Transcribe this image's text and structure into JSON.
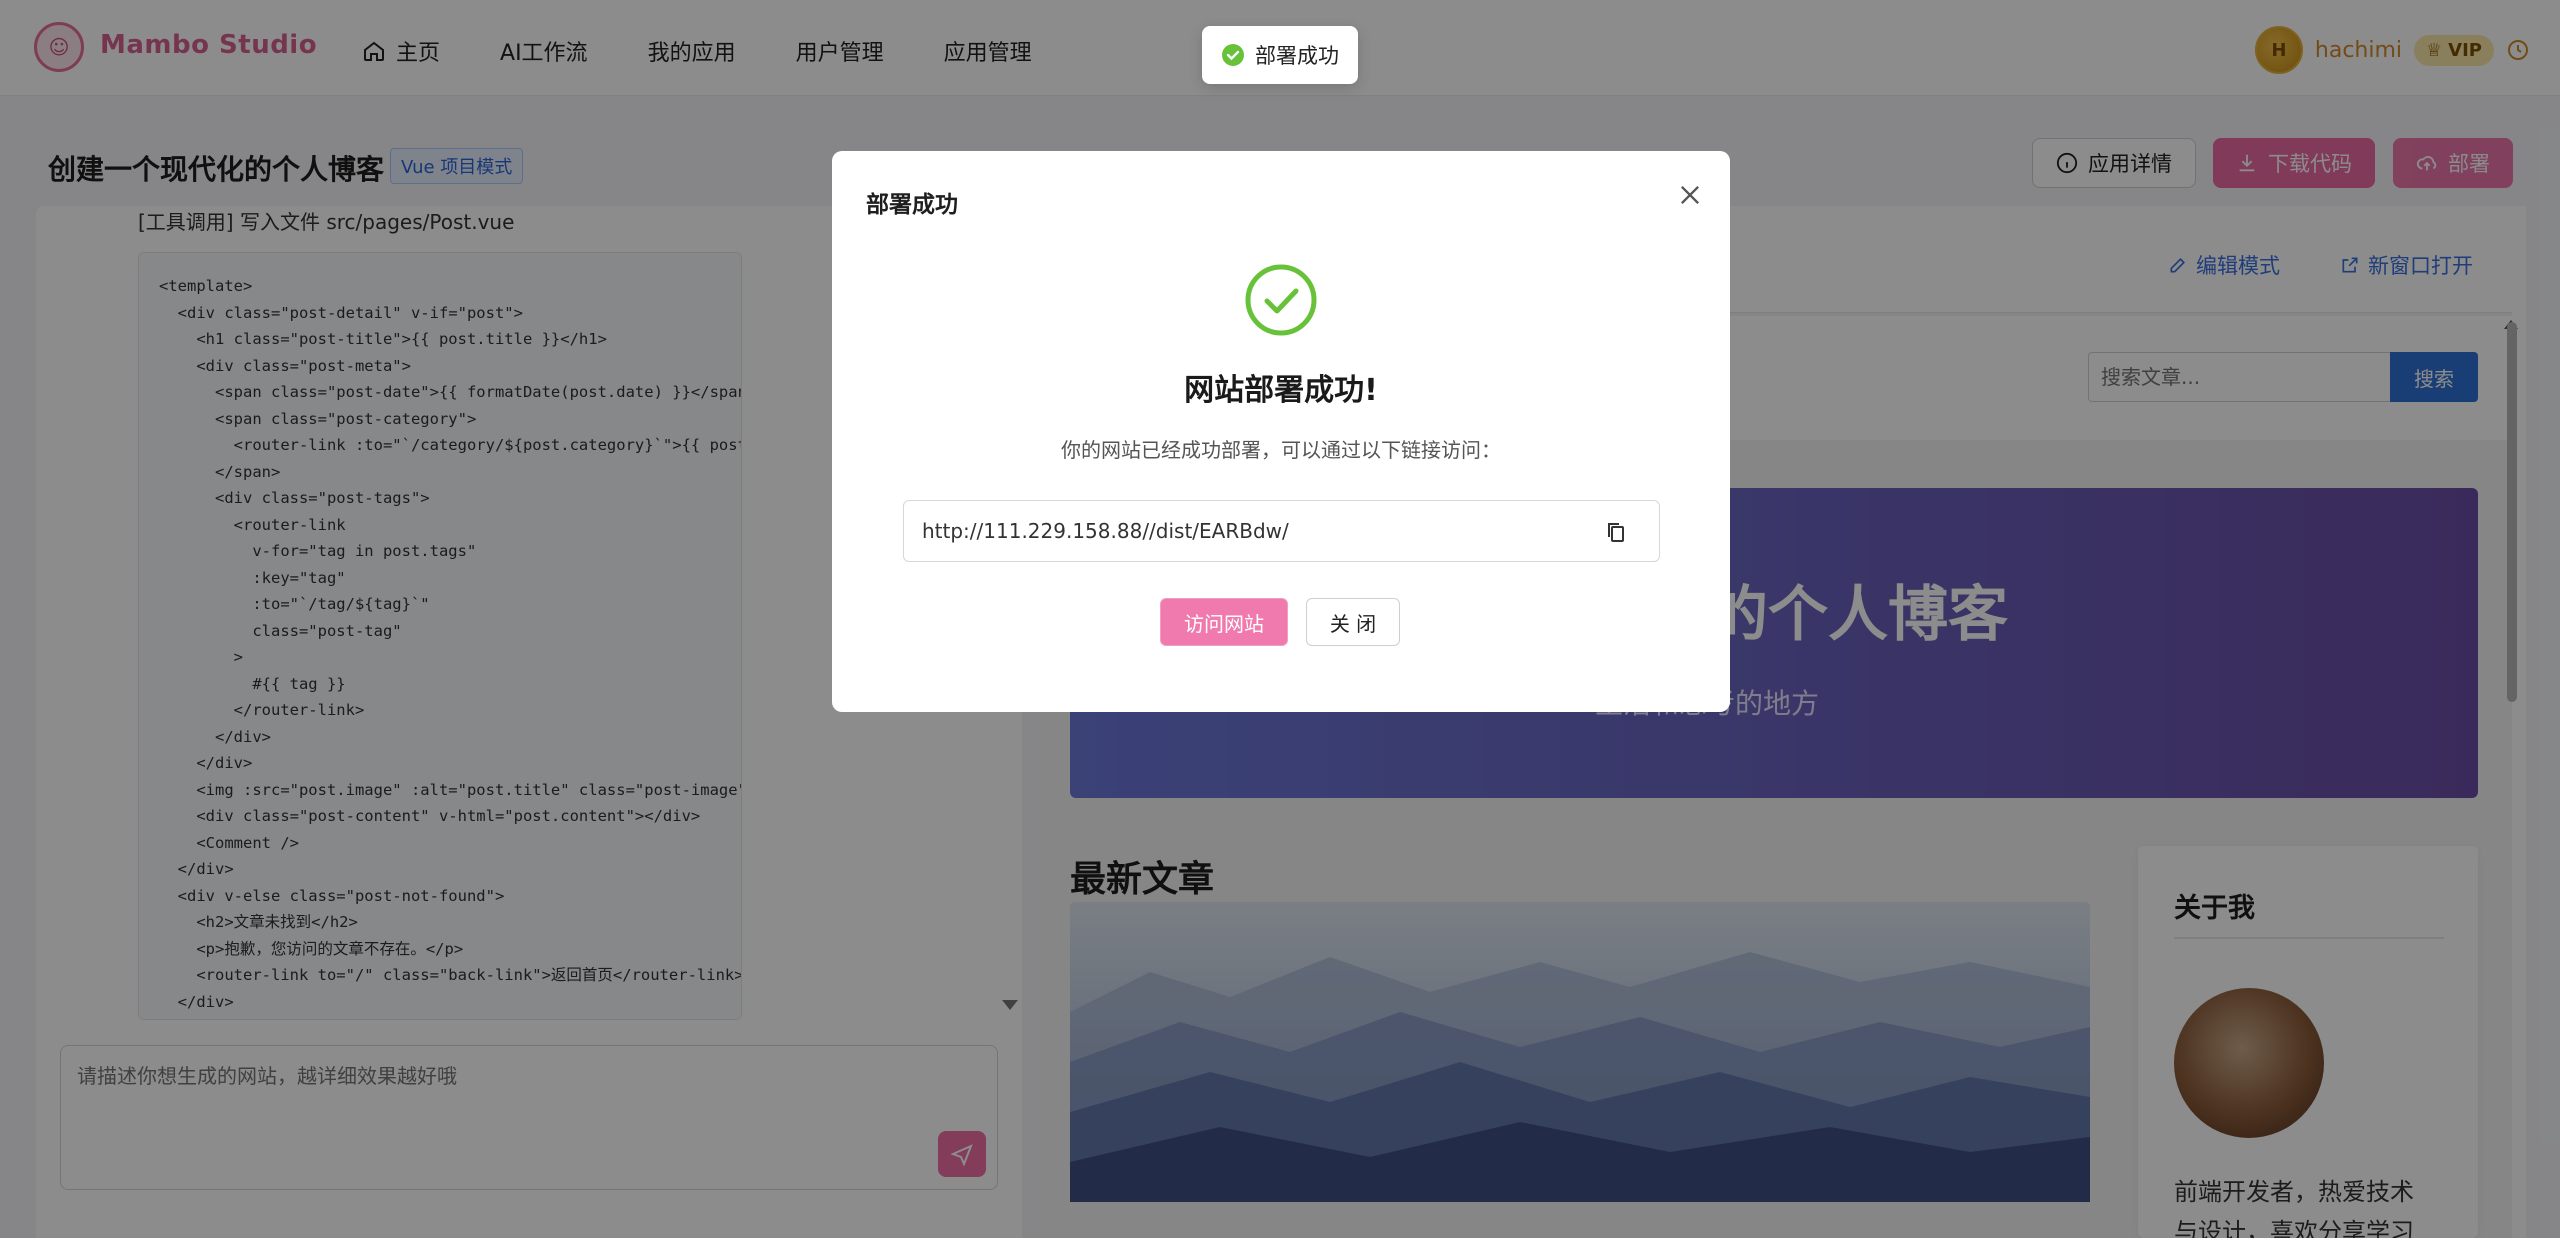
{
  "header": {
    "brand": "Mambo Studio",
    "nav": [
      {
        "label": "主页",
        "icon": "home-icon"
      },
      {
        "label": "AI工作流"
      },
      {
        "label": "我的应用"
      },
      {
        "label": "用户管理"
      },
      {
        "label": "应用管理"
      }
    ],
    "user": {
      "name": "hachimi",
      "vip_label": "VIP",
      "avatar_letter": "H"
    }
  },
  "toolbar": {
    "page_title": "创建一个现代化的个人博客",
    "mode_tag": "Vue 项目模式",
    "detail_label": "应用详情",
    "download_label": "下载代码",
    "deploy_label": "部署"
  },
  "left": {
    "code_intro": "[工具调用] 写入文件 src/pages/Post.vue",
    "code_lines": [
      "<template>",
      "  <div class=\"post-detail\" v-if=\"post\">",
      "    <h1 class=\"post-title\">{{ post.title }}</h1>",
      "    <div class=\"post-meta\">",
      "      <span class=\"post-date\">{{ formatDate(post.date) }}</span>",
      "      <span class=\"post-category\">",
      "        <router-link :to=\"`/category/${post.category}`\">{{ post.c",
      "      </span>",
      "      <div class=\"post-tags\">",
      "        <router-link",
      "          v-for=\"tag in post.tags\"",
      "          :key=\"tag\"",
      "          :to=\"`/tag/${tag}`\"",
      "          class=\"post-tag\"",
      "        >",
      "          #{{ tag }}",
      "        </router-link>",
      "      </div>",
      "    </div>",
      "    <img :src=\"post.image\" :alt=\"post.title\" class=\"post-image\" /",
      "    <div class=\"post-content\" v-html=\"post.content\"></div>",
      "    <Comment />",
      "  </div>",
      "  <div v-else class=\"post-not-found\">",
      "    <h2>文章未找到</h2>",
      "    <p>抱歉，您访问的文章不存在。</p>",
      "    <router-link to=\"/\" class=\"back-link\">返回首页</router-link>",
      "  </div>"
    ],
    "prompt_placeholder": "请描述你想生成的网站，越详细效果越好哦"
  },
  "preview": {
    "edit_mode_label": "编辑模式",
    "new_window_label": "新窗口打开",
    "nav_fragment": ":",
    "search_placeholder": "搜索文章...",
    "search_button": "搜索",
    "hero_title": "我的个人博客",
    "hero_subtitle": "生活和思考的地方",
    "latest_title": "最新文章",
    "about_title": "关于我",
    "about_text": "前端开发者，热爱技术与设计，喜欢分享学习心"
  },
  "modal": {
    "title": "部署成功",
    "headline": "网站部署成功!",
    "description": "你的网站已经成功部署，可以通过以下链接访问：",
    "url": "http://111.229.158.88//dist/EARBdw/",
    "visit_label": "访问网站",
    "close_label": "关 闭"
  },
  "toast": {
    "message": "部署成功"
  },
  "colors": {
    "brand": "#d8628f",
    "primary_pink": "#ec6aa3",
    "link_blue": "#3a6fe0",
    "success_green": "#67c23a"
  }
}
